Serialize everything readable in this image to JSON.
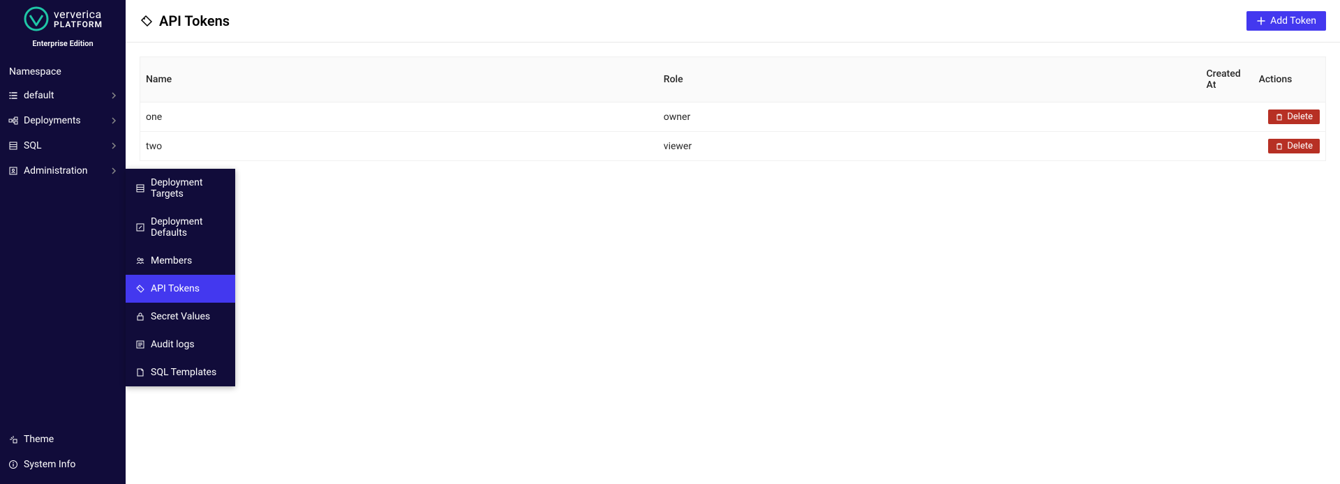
{
  "brand": {
    "name": "ververica",
    "platform": "PLATFORM",
    "edition": "Enterprise Edition"
  },
  "sidebar": {
    "namespace_label": "Namespace",
    "items": [
      {
        "label": "default"
      },
      {
        "label": "Deployments"
      },
      {
        "label": "SQL"
      },
      {
        "label": "Administration"
      }
    ],
    "bottom": [
      {
        "label": "Theme"
      },
      {
        "label": "System Info"
      }
    ]
  },
  "submenu": {
    "items": [
      {
        "label": "Deployment Targets"
      },
      {
        "label": "Deployment Defaults"
      },
      {
        "label": "Members"
      },
      {
        "label": "API Tokens"
      },
      {
        "label": "Secret Values"
      },
      {
        "label": "Audit logs"
      },
      {
        "label": "SQL Templates"
      }
    ]
  },
  "header": {
    "title": "API Tokens",
    "add_button_label": "Add Token"
  },
  "table": {
    "columns": {
      "name": "Name",
      "role": "Role",
      "created_at": "Created At",
      "actions": "Actions"
    },
    "rows": [
      {
        "name": "one",
        "role": "owner",
        "created_at": ""
      },
      {
        "name": "two",
        "role": "viewer",
        "created_at": ""
      }
    ],
    "delete_label": "Delete"
  }
}
